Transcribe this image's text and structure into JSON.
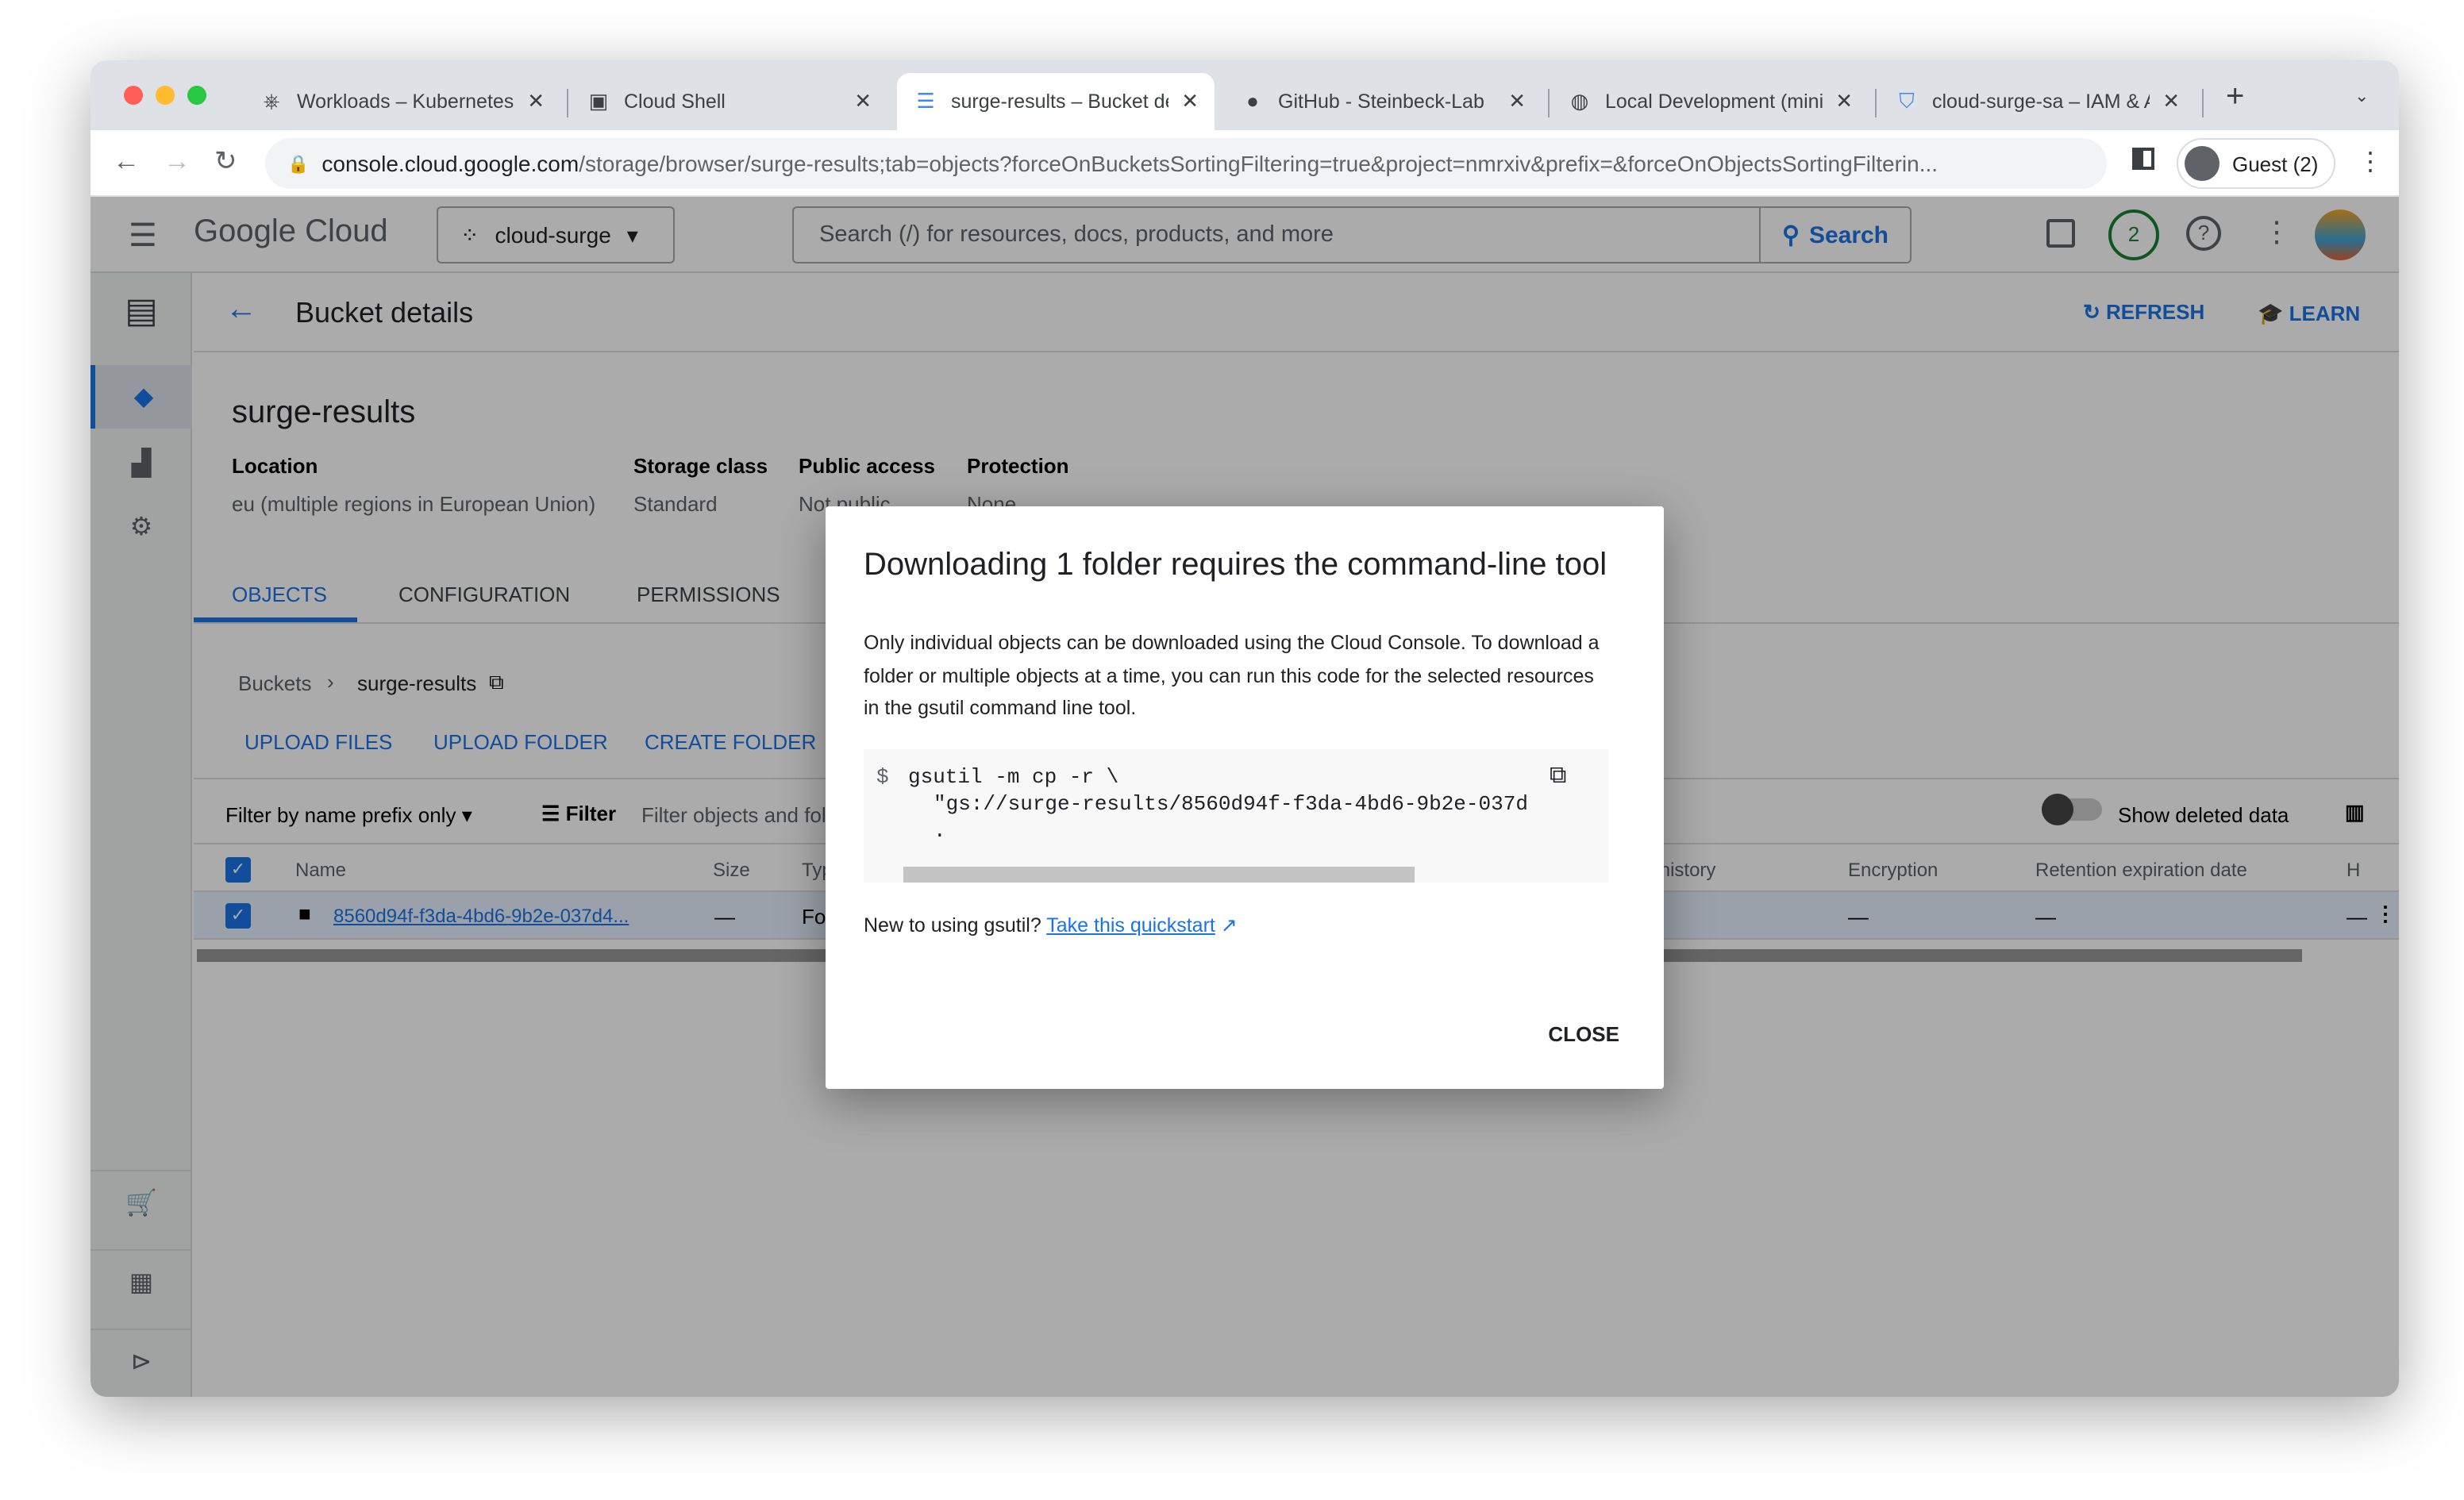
{
  "browser": {
    "tabs": [
      {
        "title": "Workloads – Kubernetes",
        "icon": "kubernetes-icon"
      },
      {
        "title": "Cloud Shell",
        "icon": "terminal-icon"
      },
      {
        "title": "surge-results – Bucket details",
        "icon": "storage-icon",
        "active": true
      },
      {
        "title": "GitHub - Steinbeck-Lab",
        "icon": "github-icon"
      },
      {
        "title": "Local Development (minikube)",
        "icon": "globe-icon"
      },
      {
        "title": "cloud-surge-sa – IAM & Admin",
        "icon": "shield-icon"
      }
    ],
    "url_domain": "console.cloud.google.com",
    "url_path": "/storage/browser/surge-results;tab=objects?forceOnBucketsSortingFiltering=true&project=nmrxiv&prefix=&forceOnObjectsSortingFilterin...",
    "profile": "Guest (2)"
  },
  "header": {
    "logo": "Google Cloud",
    "project": "cloud-surge",
    "search_placeholder": "Search (/) for resources, docs, products, and more",
    "search_button": "Search",
    "notifications": "2"
  },
  "page": {
    "title": "Bucket details",
    "refresh": "REFRESH",
    "learn": "LEARN",
    "bucket_name": "surge-results",
    "props": [
      {
        "label": "Location",
        "value": "eu (multiple regions in European Union)"
      },
      {
        "label": "Storage class",
        "value": "Standard"
      },
      {
        "label": "Public access",
        "value": "Not public"
      },
      {
        "label": "Protection",
        "value": "None"
      }
    ],
    "tabs": [
      "OBJECTS",
      "CONFIGURATION",
      "PERMISSIONS"
    ],
    "breadcrumb": [
      "Buckets",
      "surge-results"
    ],
    "actions": [
      "UPLOAD FILES",
      "UPLOAD FOLDER",
      "CREATE FOLDER"
    ],
    "filter_mode": "Filter by name prefix only",
    "filter_label": "Filter",
    "filter_placeholder": "Filter objects and folders",
    "show_deleted": "Show deleted data",
    "columns": [
      "Name",
      "Size",
      "Type",
      "Version history",
      "Encryption",
      "Retention expiration date",
      "H"
    ],
    "rows": [
      {
        "name": "8560d94f-f3da-4bd6-9b2e-037d4...",
        "size": "—",
        "type": "Folder",
        "encryption": "—",
        "retention": "—",
        "h": "—"
      }
    ]
  },
  "dialog": {
    "title": "Downloading 1 folder requires the command-line tool",
    "body": "Only individual objects can be downloaded using the Cloud Console. To download a folder or multiple objects at a time, you can run this code for the selected resources in the gsutil command line tool.",
    "prompt": "$",
    "code_line1": "gsutil -m cp -r \\",
    "code_line2": "\"gs://surge-results/8560d94f-f3da-4bd6-9b2e-037d",
    "code_line3": ".",
    "new_text": "New to using gsutil?",
    "link": "Take this quickstart",
    "close": "CLOSE"
  }
}
